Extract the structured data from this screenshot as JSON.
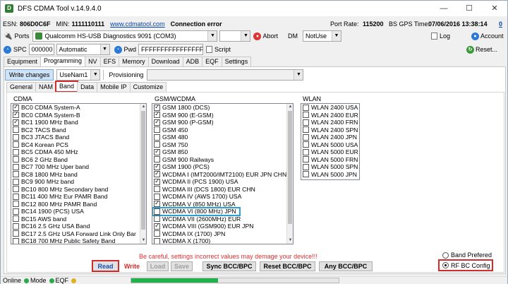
{
  "title": "DFS CDMA Tool v.14.9.4.0",
  "window_buttons": [
    "—",
    "☐",
    "✕"
  ],
  "info": {
    "esn_label": "ESN:",
    "esn": "806D0C6F",
    "min_label": "MIN:",
    "min": "1111110111",
    "link": "www.cdmatool.com",
    "connection": "Connection error",
    "port_rate_label": "Port Rate:",
    "port_rate": "115200",
    "gps_label": "BS GPS Time:",
    "gps_time": "07/06/2016 13:38:14",
    "extra": "0"
  },
  "toolbar1": {
    "ports": "Ports",
    "port_value": "Qualcomm HS-USB Diagnostics 9091 (COM3)",
    "abort": "Abort",
    "dm_label": "DM",
    "dm_value": "NotUse",
    "log": "Log",
    "account": "Account"
  },
  "toolbar2": {
    "spc": "SPC",
    "spc_value": "000000",
    "mode_value": "Automatic",
    "pwd": "Pwd",
    "pwd_value": "FFFFFFFFFFFFFFFF",
    "script": "Script",
    "reset": "Reset..."
  },
  "main_tabs": [
    "Equipment",
    "Programming",
    "NV",
    "EFS",
    "Memory",
    "Download",
    "ADB",
    "EQF",
    "Settings"
  ],
  "prog_bar": {
    "write_changes": "Write changes",
    "nam_value": "UseNam1",
    "provisioning": "Provisioning"
  },
  "sub_tabs": [
    "General",
    "NAM",
    "Band",
    "Data",
    "Mobile IP",
    "Customize"
  ],
  "cdma": {
    "title": "CDMA",
    "items": [
      {
        "label": "BC0 CDMA System-A",
        "checked": true
      },
      {
        "label": "BC0 CDMA System-B",
        "checked": true
      },
      {
        "label": "BC1 1900 MHz Band",
        "checked": true
      },
      {
        "label": "BC2 TACS Band",
        "checked": false
      },
      {
        "label": "BC3 JTACS Band",
        "checked": false
      },
      {
        "label": "BC4 Korean PCS",
        "checked": false
      },
      {
        "label": "BC5 CDMA 450 MHz",
        "checked": false
      },
      {
        "label": "BC6 2 GHz Band",
        "checked": false
      },
      {
        "label": "BC7 700 MHz Uper band",
        "checked": false
      },
      {
        "label": "BC8 1800 MHz band",
        "checked": false
      },
      {
        "label": "BC9 900 MHz band",
        "checked": false
      },
      {
        "label": "BC10 800 MHz Secondary band",
        "checked": false
      },
      {
        "label": "BC11 400 MHz Eur PAMR Band",
        "checked": false
      },
      {
        "label": "BC12 800 MHz PAMR Band",
        "checked": false
      },
      {
        "label": "BC14 1900 (PCS) USA",
        "checked": false
      },
      {
        "label": "BC15 AWS band",
        "checked": false
      },
      {
        "label": "BC16 2.5 GHz USA Band",
        "checked": false
      },
      {
        "label": "BC17 2.5 GHz USA Forward Link Only Bar",
        "checked": false
      },
      {
        "label": "BC18 700 MHz Public Safety Band",
        "checked": false
      }
    ]
  },
  "gsm": {
    "title": "GSM/WCDMA",
    "items": [
      {
        "label": "GSM 1800 (DCS)",
        "checked": true
      },
      {
        "label": "GSM 900 (E-GSM)",
        "checked": true
      },
      {
        "label": "GSM 900 (P-GSM)",
        "checked": true
      },
      {
        "label": "GSM 450",
        "checked": false
      },
      {
        "label": "GSM 480",
        "checked": false
      },
      {
        "label": "GSM 750",
        "checked": false
      },
      {
        "label": "GSM 850",
        "checked": true
      },
      {
        "label": "GSM 900 Railways",
        "checked": false
      },
      {
        "label": "GSM 1900 (PCS)",
        "checked": true
      },
      {
        "label": "WCDMA I (IMT2000/IMT2100) EUR JPN CHN",
        "checked": true
      },
      {
        "label": "WCDMA II (PCS 1900) USA",
        "checked": true
      },
      {
        "label": "WCDMA III (DCS 1800) EUR CHN",
        "checked": false
      },
      {
        "label": "WCDMA IV (AWS 1700) USA",
        "checked": false
      },
      {
        "label": "WCDMA V (850 MHz) USA",
        "checked": true
      },
      {
        "label": "WCDMA VI (800 MHz) JPN",
        "checked": false
      },
      {
        "label": "WCDMA VII (2600MHz) EUR",
        "checked": false
      },
      {
        "label": "WCDMA VIII (GSM900) EUR JPN",
        "checked": true
      },
      {
        "label": "WCDMA IX (1700) JPN",
        "checked": false
      },
      {
        "label": "WCDMA X (1700)",
        "checked": false
      }
    ]
  },
  "wlan": {
    "title": "WLAN",
    "items": [
      {
        "label": "WLAN 2400 USA",
        "checked": false
      },
      {
        "label": "WLAN 2400 EUR",
        "checked": false
      },
      {
        "label": "WLAN 2400 FRN",
        "checked": false
      },
      {
        "label": "WLAN 2400 SPN",
        "checked": false
      },
      {
        "label": "WLAN 2400 JPN",
        "checked": false
      },
      {
        "label": "WLAN 5000 USA",
        "checked": false
      },
      {
        "label": "WLAN 5000 EUR",
        "checked": false
      },
      {
        "label": "WLAN 5000 FRN",
        "checked": false
      },
      {
        "label": "WLAN 5000 SPN",
        "checked": false
      },
      {
        "label": "WLAN 5000 JPN",
        "checked": false
      }
    ]
  },
  "warning": "Be careful, settings incorrect values may demage your device!!!",
  "buttons": {
    "read": "Read",
    "write": "Write",
    "load": "Load",
    "save": "Save",
    "sync": "Sync BCC/BPC",
    "reset": "Reset BCC/BPC",
    "any": "Any BCC/BPC"
  },
  "radios": {
    "band_preferred": "Band Prefered",
    "rf_bc_config": "RF BC Config"
  },
  "status": {
    "online": "Online",
    "mode": "Mode",
    "eqf": "EQF"
  },
  "colors": {
    "highlight_red": "#d22b2b",
    "highlight_blue": "#2a9fd6",
    "warning_red": "#e03030",
    "progress_green": "#21b24b"
  }
}
